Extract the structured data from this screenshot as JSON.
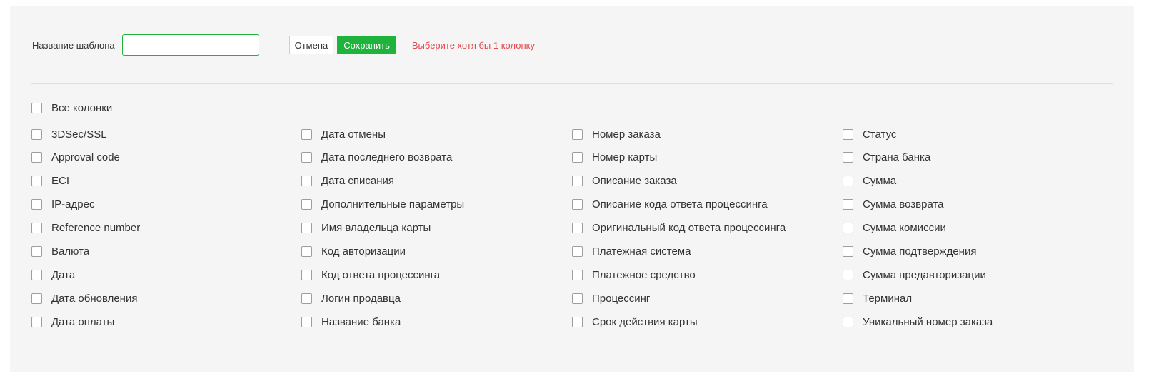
{
  "template": {
    "label": "Название шаблона",
    "value": "",
    "placeholder": ""
  },
  "actions": {
    "cancel_label": "Отмена",
    "save_label": "Сохранить",
    "error_message": "Выберите хотя бы 1 колонку"
  },
  "all_columns": {
    "label": "Все колонки",
    "checked": false
  },
  "columns": [
    [
      "3DSec/SSL",
      "Approval code",
      "ECI",
      "IP-адрес",
      "Reference number",
      "Валюта",
      "Дата",
      "Дата обновления",
      "Дата оплаты"
    ],
    [
      "Дата отмены",
      "Дата последнего возврата",
      "Дата списания",
      "Дополнительные параметры",
      "Имя владельца карты",
      "Код авторизации",
      "Код ответа процессинга",
      "Логин продавца",
      "Название банка"
    ],
    [
      "Номер заказа",
      "Номер карты",
      "Описание заказа",
      "Описание кода ответа процессинга",
      "Оригинальный код ответа процессинга",
      "Платежная система",
      "Платежное средство",
      "Процессинг",
      "Срок действия карты"
    ],
    [
      "Статус",
      "Страна банка",
      "Сумма",
      "Сумма возврата",
      "Сумма комиссии",
      "Сумма подтверждения",
      "Сумма предавторизации",
      "Терминал",
      "Уникальный номер заказа"
    ]
  ],
  "colors": {
    "accent": "#1eb43c",
    "error": "#e5484d",
    "panel_bg": "#f5f5f5"
  }
}
